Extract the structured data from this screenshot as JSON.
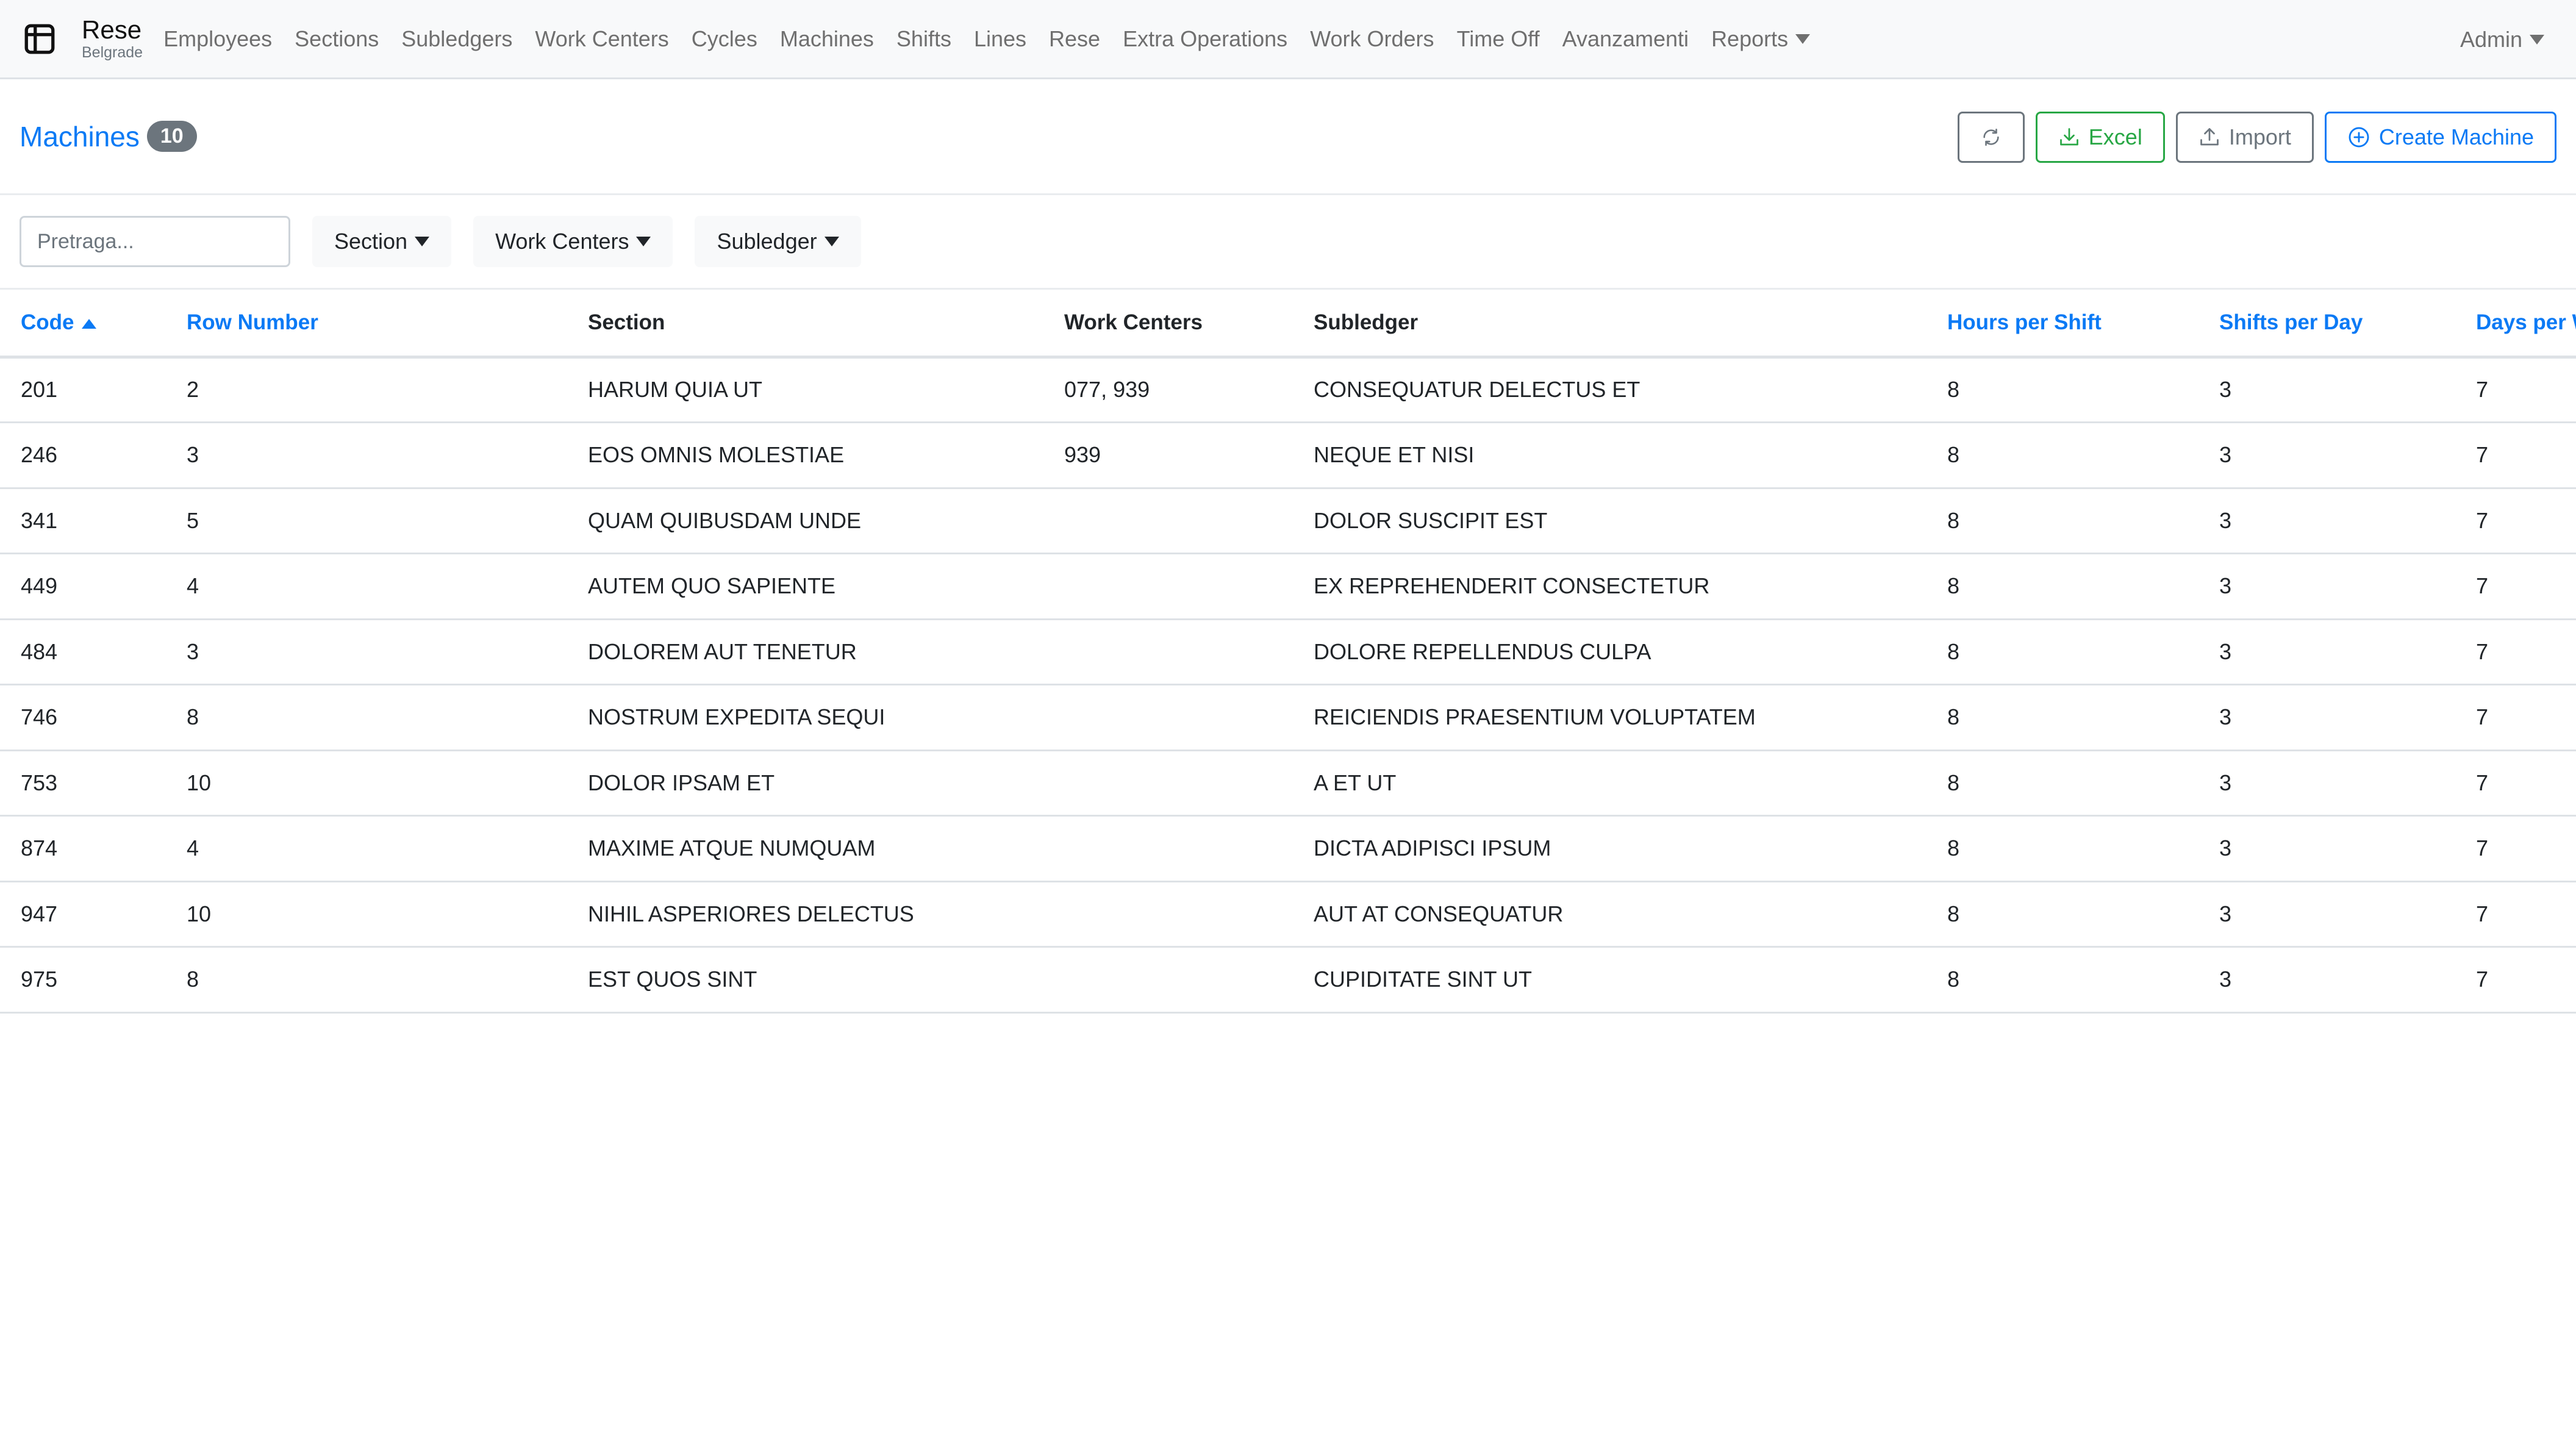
{
  "navbar": {
    "brand_title": "Rese",
    "brand_subtitle": "Belgrade",
    "items": [
      {
        "label": "Employees"
      },
      {
        "label": "Sections"
      },
      {
        "label": "Subledgers"
      },
      {
        "label": "Work Centers"
      },
      {
        "label": "Cycles"
      },
      {
        "label": "Machines"
      },
      {
        "label": "Shifts"
      },
      {
        "label": "Lines"
      },
      {
        "label": "Rese"
      },
      {
        "label": "Extra Operations"
      },
      {
        "label": "Work Orders"
      },
      {
        "label": "Time Off"
      },
      {
        "label": "Avanzamenti"
      },
      {
        "label": "Reports",
        "dropdown": true
      }
    ],
    "user_menu": "Admin"
  },
  "page": {
    "title": "Machines",
    "count": "10",
    "actions": {
      "refresh_icon": "refresh-icon",
      "excel_label": "Excel",
      "import_label": "Import",
      "create_label": "Create Machine"
    }
  },
  "filters": {
    "search_placeholder": "Pretraga...",
    "search_value": "",
    "dropdowns": [
      {
        "label": "Section"
      },
      {
        "label": "Work Centers"
      },
      {
        "label": "Subledger"
      }
    ]
  },
  "table": {
    "columns": [
      {
        "label": "Code",
        "sortable": true,
        "sort": "asc"
      },
      {
        "label": "Row Number",
        "sortable": true
      },
      {
        "label": "Section",
        "sortable": false
      },
      {
        "label": "Work Centers",
        "sortable": false
      },
      {
        "label": "Subledger",
        "sortable": false
      },
      {
        "label": "Hours per Shift",
        "sortable": true
      },
      {
        "label": "Shifts per Day",
        "sortable": true
      },
      {
        "label": "Days per Week",
        "sortable": true
      }
    ],
    "rows": [
      [
        "201",
        "2",
        "HARUM QUIA UT",
        "077, 939",
        "CONSEQUATUR DELECTUS ET",
        "8",
        "3",
        "7"
      ],
      [
        "246",
        "3",
        "EOS OMNIS MOLESTIAE",
        "939",
        "NEQUE ET NISI",
        "8",
        "3",
        "7"
      ],
      [
        "341",
        "5",
        "QUAM QUIBUSDAM UNDE",
        "",
        "DOLOR SUSCIPIT EST",
        "8",
        "3",
        "7"
      ],
      [
        "449",
        "4",
        "AUTEM QUO SAPIENTE",
        "",
        "EX REPREHENDERIT CONSECTETUR",
        "8",
        "3",
        "7"
      ],
      [
        "484",
        "3",
        "DOLOREM AUT TENETUR",
        "",
        "DOLORE REPELLENDUS CULPA",
        "8",
        "3",
        "7"
      ],
      [
        "746",
        "8",
        "NOSTRUM EXPEDITA SEQUI",
        "",
        "REICIENDIS PRAESENTIUM VOLUPTATEM",
        "8",
        "3",
        "7"
      ],
      [
        "753",
        "10",
        "DOLOR IPSAM ET",
        "",
        "A ET UT",
        "8",
        "3",
        "7"
      ],
      [
        "874",
        "4",
        "MAXIME ATQUE NUMQUAM",
        "",
        "DICTA ADIPISCI IPSUM",
        "8",
        "3",
        "7"
      ],
      [
        "947",
        "10",
        "NIHIL ASPERIORES DELECTUS",
        "",
        "AUT AT CONSEQUATUR",
        "8",
        "3",
        "7"
      ],
      [
        "975",
        "8",
        "EST QUOS SINT",
        "",
        "CUPIDITATE SINT UT",
        "8",
        "3",
        "7"
      ]
    ]
  },
  "colors": {
    "primary": "#0b7af5",
    "success": "#28a745",
    "secondary": "#6c757d",
    "navbar_bg": "#f8f9fa"
  }
}
